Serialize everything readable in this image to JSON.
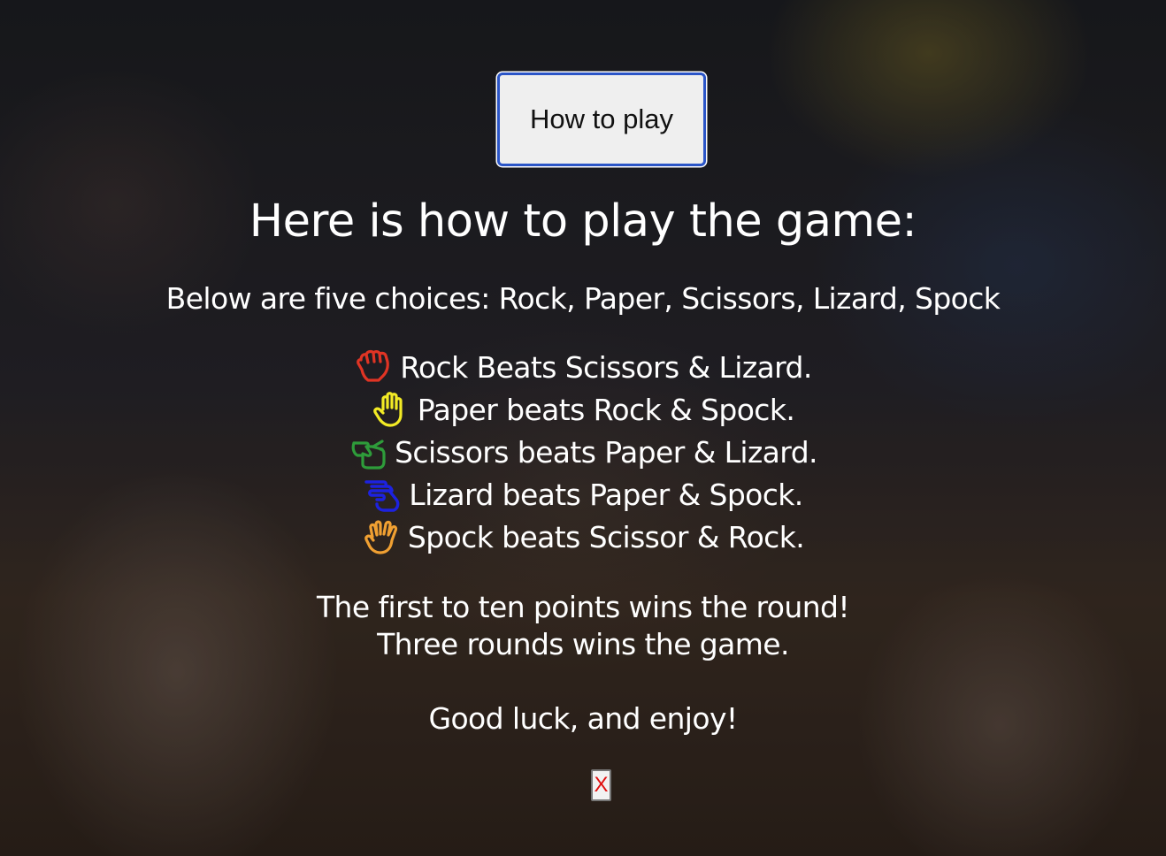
{
  "header": {
    "how_to_play_label": "How to play"
  },
  "modal": {
    "title": "Here is how to play the game:",
    "intro": "Below are five choices: Rock, Paper, Scissors, Lizard, Spock",
    "rules": [
      {
        "icon": "rock-hand-icon",
        "color": "#e03424",
        "text": "Rock Beats Scissors & Lizard."
      },
      {
        "icon": "paper-hand-icon",
        "color": "#f2ea25",
        "text": "Paper beats Rock & Spock."
      },
      {
        "icon": "scissors-hand-icon",
        "color": "#2e9c3a",
        "text": "Scissors beats Paper & Lizard."
      },
      {
        "icon": "lizard-hand-icon",
        "color": "#1d22e0",
        "text": "Lizard beats Paper & Spock."
      },
      {
        "icon": "spock-hand-icon",
        "color": "#f0a032",
        "text": "Spock beats Scissor & Rock."
      }
    ],
    "outro_line_1": "The first to ten points wins the round!",
    "outro_line_2": "Three rounds wins the game.",
    "outro_line_3": "Good luck, and enjoy!",
    "close_label": "X"
  },
  "colors": {
    "button_border": "#2b55c7",
    "close_x": "#e01010",
    "text": "#ffffff"
  }
}
